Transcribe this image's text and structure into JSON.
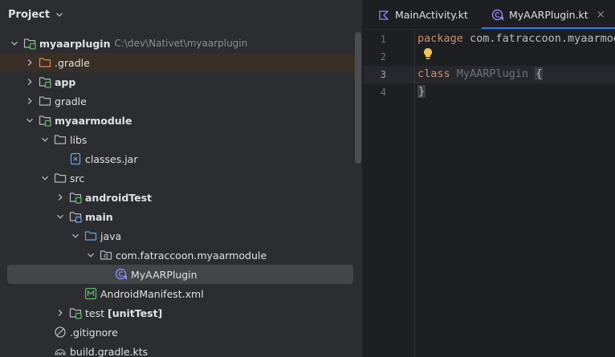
{
  "project_panel": {
    "title": "Project",
    "tree": [
      {
        "label": "myaarplugin",
        "hint": "C:\\dev\\Nativet\\myaarplugin",
        "bold": true,
        "depth": 0,
        "chevron": "down",
        "icon": "module-folder-icon"
      },
      {
        "label": ".gradle",
        "bold": false,
        "depth": 1,
        "chevron": "right",
        "icon": "excluded-folder-icon"
      },
      {
        "label": "app",
        "bold": true,
        "depth": 1,
        "chevron": "right",
        "icon": "module-folder-icon"
      },
      {
        "label": "gradle",
        "bold": false,
        "depth": 1,
        "chevron": "right",
        "icon": "folder-icon"
      },
      {
        "label": "myaarmodule",
        "bold": true,
        "depth": 1,
        "chevron": "down",
        "icon": "module-folder-icon"
      },
      {
        "label": "libs",
        "bold": false,
        "depth": 2,
        "chevron": "down",
        "icon": "folder-icon"
      },
      {
        "label": "classes.jar",
        "bold": false,
        "depth": 3,
        "chevron": "none",
        "icon": "jar-file-icon"
      },
      {
        "label": "src",
        "bold": false,
        "depth": 2,
        "chevron": "down",
        "icon": "folder-icon"
      },
      {
        "label": "androidTest",
        "bold": true,
        "depth": 3,
        "chevron": "right",
        "icon": "test-folder-icon"
      },
      {
        "label": "main",
        "bold": true,
        "depth": 3,
        "chevron": "down",
        "icon": "source-set-folder-icon"
      },
      {
        "label": "java",
        "bold": false,
        "depth": 4,
        "chevron": "down",
        "icon": "source-root-folder-icon"
      },
      {
        "label": "com.fatraccoon.myaarmodule",
        "bold": false,
        "depth": 5,
        "chevron": "down",
        "icon": "package-icon"
      },
      {
        "label": "MyAARPlugin",
        "bold": false,
        "depth": 6,
        "chevron": "none",
        "icon": "kotlin-class-icon"
      },
      {
        "label": "AndroidManifest.xml",
        "bold": false,
        "depth": 4,
        "chevron": "none",
        "icon": "manifest-icon"
      },
      {
        "label": "test",
        "suffix": "[unitTest]",
        "bold": false,
        "depth": 3,
        "chevron": "right",
        "icon": "test-folder-icon"
      },
      {
        "label": ".gitignore",
        "bold": false,
        "depth": 2,
        "chevron": "none",
        "icon": "ignore-file-icon"
      },
      {
        "label": "build.gradle.kts",
        "bold": false,
        "depth": 2,
        "chevron": "none",
        "icon": "gradle-file-icon"
      }
    ]
  },
  "editor": {
    "tabs": [
      {
        "label": "MainActivity.kt",
        "icon": "kotlin-file-icon",
        "active": false
      },
      {
        "label": "MyAARPlugin.kt",
        "icon": "kotlin-class-icon",
        "active": true
      }
    ],
    "close_glyph": "×",
    "line_numbers": [
      "1",
      "2",
      "3",
      "4"
    ],
    "code": {
      "line1_kw": "package",
      "line1_rest": " com.fatraccoon.myaarmodule",
      "line3_kw": "class",
      "line3_name": " MyAARPlugin ",
      "line3_brace": "{",
      "line4_brace": "}"
    }
  },
  "colors": {
    "accent": "#3574f0",
    "keyword": "#cf8e6d",
    "module_badge": "#5fb865",
    "kotlin_class": "#8f88f2"
  }
}
